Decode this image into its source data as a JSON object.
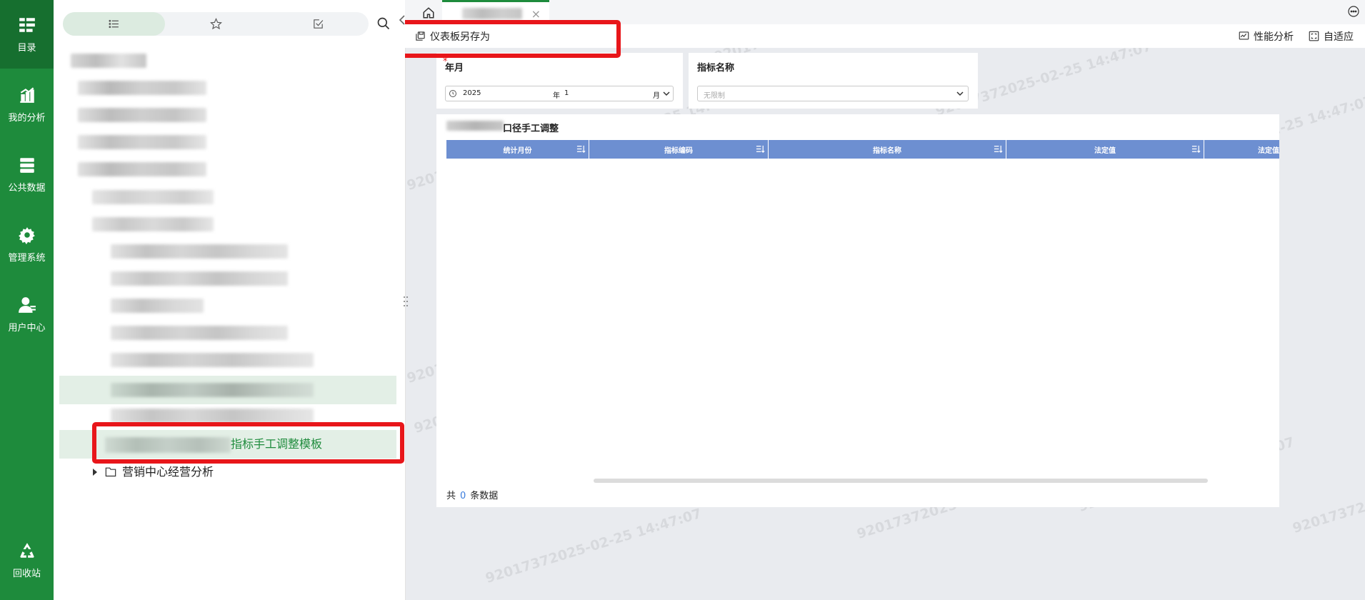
{
  "rail": {
    "items": [
      {
        "label": "目录",
        "icon": "catalog-icon"
      },
      {
        "label": "我的分析",
        "icon": "analysis-icon"
      },
      {
        "label": "公共数据",
        "icon": "database-icon"
      },
      {
        "label": "管理系统",
        "icon": "gear-icon"
      },
      {
        "label": "用户中心",
        "icon": "user-icon"
      }
    ],
    "recycle": {
      "label": "回收站",
      "icon": "recycle-icon"
    }
  },
  "catalog": {
    "tabs": [
      {
        "icon": "list-icon"
      },
      {
        "icon": "star-icon"
      },
      {
        "icon": "checkbox-icon"
      }
    ],
    "selected_item": {
      "label": "指标手工调整模板"
    },
    "folder_item": {
      "label": "营销中心经营分析"
    }
  },
  "toolbar": {
    "save_as": "仪表板另存为",
    "perf": "性能分析",
    "fit": "自适应"
  },
  "filters": {
    "ym": {
      "label": "年月",
      "year": "2025",
      "year_unit": "年",
      "month": "1",
      "month_unit": "月"
    },
    "indicator": {
      "label": "指标名称",
      "placeholder": "无限制"
    }
  },
  "table": {
    "title_suffix": "口径手工调整",
    "columns": [
      "统计月份",
      "指标编码",
      "指标名称",
      "法定值",
      "法定值"
    ],
    "footer_prefix": "共",
    "count": "0",
    "footer_suffix": "条数据"
  },
  "watermark": "92017372025-02-25 14:47:07",
  "colors": {
    "rail": "#1e8b3c",
    "header": "#6d8fd1",
    "highlight": "#e3efe6",
    "annotation": "#e8161a"
  }
}
